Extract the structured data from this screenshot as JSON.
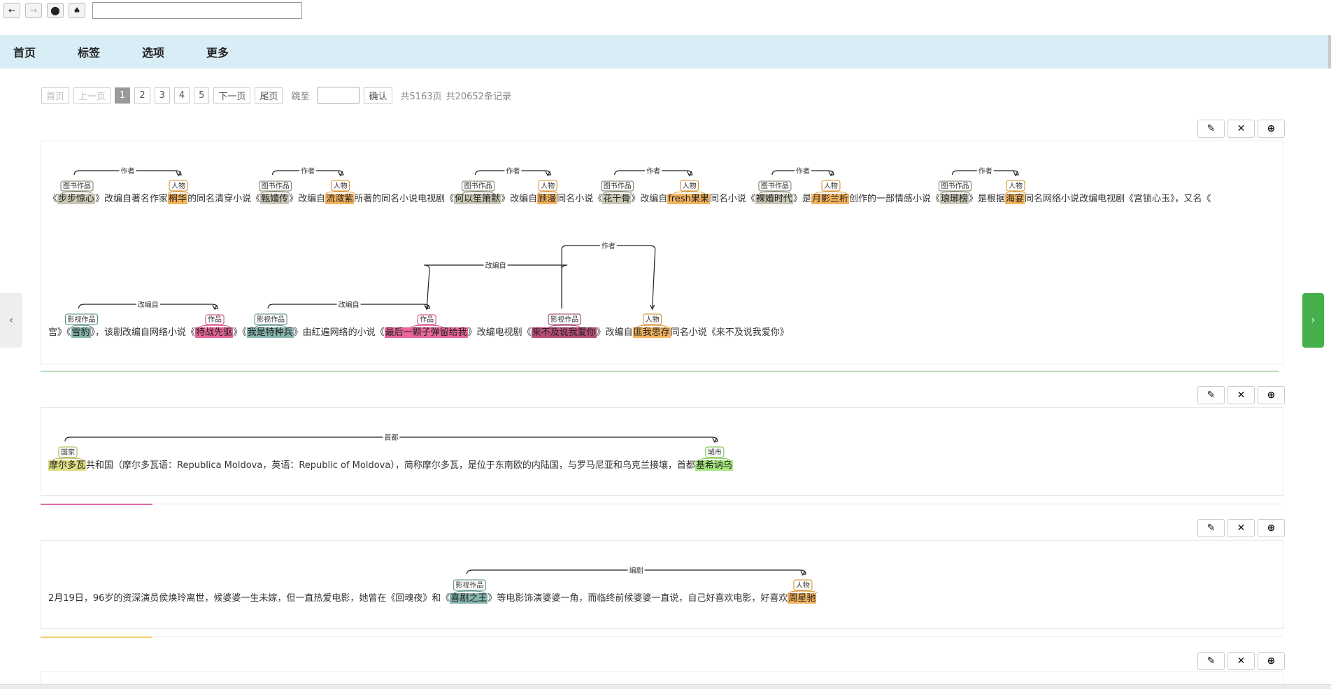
{
  "toolbar": {
    "back_icon": "←",
    "forward_icon": "→",
    "record_icon": "⬤",
    "spade_icon": "♠",
    "url_value": ""
  },
  "nav": {
    "items": [
      "首页",
      "标签",
      "选项",
      "更多"
    ]
  },
  "pager": {
    "first": "首页",
    "prev": "上一页",
    "pages": [
      "1",
      "2",
      "3",
      "4",
      "5"
    ],
    "next": "下一页",
    "last": "尾页",
    "jump_label": "跳至",
    "confirm": "确认",
    "total_pages": "共5163页",
    "total_records": "共20652条记录"
  },
  "side": {
    "left_icon": "‹",
    "right_icon": "›"
  },
  "actions": {
    "edit_icon": "✎",
    "delete_icon": "✕",
    "add_icon": "⊕"
  },
  "colors": {
    "separator_green": "#4caf50",
    "separator_pink": "#e06aa8",
    "separator_yellow": "#f2d06b"
  },
  "records": {
    "r1": {
      "line1": [
        {
          "t": "《"
        },
        {
          "t": "步步惊心",
          "c": "book",
          "tag": "图书作品"
        },
        {
          "t": "》改编自著名作家"
        },
        {
          "t": "桐华",
          "c": "person",
          "tag": "人物"
        },
        {
          "t": "的同名清穿小说《"
        },
        {
          "t": "甄嬛传",
          "c": "book",
          "tag": "图书作品"
        },
        {
          "t": "》改编自"
        },
        {
          "t": "流潋紫",
          "c": "person",
          "tag": "人物"
        },
        {
          "t": "所著的同名小说电视剧《"
        },
        {
          "t": "何以笙箫默",
          "c": "book",
          "tag": "图书作品"
        },
        {
          "t": "》改编自"
        },
        {
          "t": "顾漫",
          "c": "person",
          "tag": "人物"
        },
        {
          "t": "同名小说《"
        },
        {
          "t": "花千骨",
          "c": "book",
          "tag": "图书作品"
        },
        {
          "t": "》改编自"
        },
        {
          "t": "fresh果果",
          "c": "person",
          "tag": "人物"
        },
        {
          "t": "同名小说《"
        },
        {
          "t": "裸婚时代",
          "c": "book",
          "tag": "图书作品"
        },
        {
          "t": "》是"
        },
        {
          "t": "月影兰析",
          "c": "person",
          "tag": "人物"
        },
        {
          "t": "创作的一部情感小说《"
        },
        {
          "t": "琅琊榜",
          "c": "book",
          "tag": "图书作品"
        },
        {
          "t": "》是根据"
        },
        {
          "t": "海宴",
          "c": "person",
          "tag": "人物"
        },
        {
          "t": "同名网络小说改编电视剧《宫锁心玉》，又名《"
        }
      ],
      "line2": [
        {
          "t": "宫》《"
        },
        {
          "t": "雪豹",
          "c": "film",
          "tag": "影视作品"
        },
        {
          "t": "》，该剧改编自网络小说《"
        },
        {
          "t": "特战先驱",
          "c": "work",
          "tag": "作品"
        },
        {
          "t": "》《"
        },
        {
          "t": "我是特种兵",
          "c": "film",
          "tag": "影视作品"
        },
        {
          "t": "》由红遍网络的小说《"
        },
        {
          "t": "最后一颗子弹留给我",
          "c": "work",
          "tag": "作品"
        },
        {
          "t": "》改编电视剧《"
        },
        {
          "t": "来不及说我爱你",
          "c": "filmw",
          "tag": "影视作品"
        },
        {
          "t": "》改编自"
        },
        {
          "t": "匪我思存",
          "c": "person",
          "tag": "人物"
        },
        {
          "t": "同名小说《来不及说我爱你》"
        }
      ],
      "rel_author": "作者",
      "rel_adapt": "改编自"
    },
    "r2": {
      "line": [
        {
          "t": "摩尔多瓦",
          "c": "country",
          "tag": "国家"
        },
        {
          "t": "共和国（摩尔多瓦语：Republica Moldova，英语：Republic of Moldova），简称摩尔多瓦，是位于东南欧的内陆国，与罗马尼亚和乌克兰接壤，首都"
        },
        {
          "t": "基希讷乌",
          "c": "city",
          "tag": "城市"
        }
      ],
      "rel": "首都"
    },
    "r3": {
      "line": [
        {
          "t": "2月19日，96岁的资深演员侯焕玲离世，候婆婆一生未嫁，但一直热爱电影，她曾在《回魂夜》和《"
        },
        {
          "t": "喜剧之王",
          "c": "film",
          "tag": "影视作品"
        },
        {
          "t": "》等电影饰演婆婆一角，而临终前候婆婆一直说，自己好喜欢电影，好喜欢"
        },
        {
          "t": "周星驰",
          "c": "person",
          "tag": "人物"
        }
      ],
      "rel": "编剧"
    }
  }
}
